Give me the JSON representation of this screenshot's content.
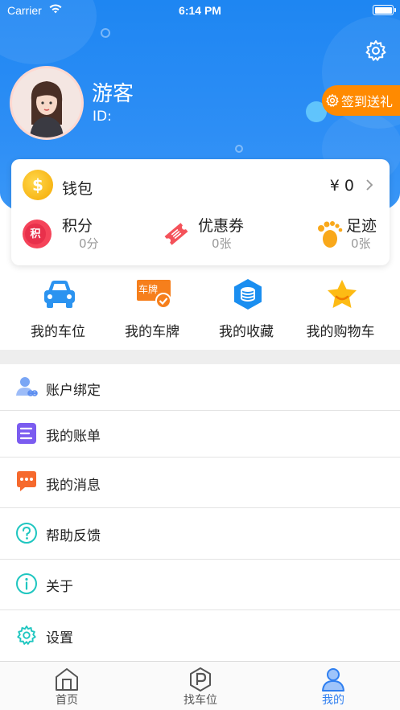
{
  "status_bar": {
    "carrier": "Carrier",
    "time": "6:14 PM"
  },
  "profile": {
    "name": "游客",
    "id_label": "ID:"
  },
  "signin": {
    "label": "签到送礼"
  },
  "wallet": {
    "label": "钱包",
    "amount": "¥ 0"
  },
  "stats": [
    {
      "title": "积分",
      "value": "0分",
      "icon": "points-icon",
      "badge": "积"
    },
    {
      "title": "优惠券",
      "value": "0张",
      "icon": "coupon-icon"
    },
    {
      "title": "足迹",
      "value": "0张",
      "icon": "footprint-icon"
    }
  ],
  "shortcuts": [
    {
      "label": "我的车位",
      "icon": "car-icon"
    },
    {
      "label": "我的车牌",
      "icon": "license-plate-icon",
      "badge": "车牌"
    },
    {
      "label": "我的收藏",
      "icon": "collection-icon"
    },
    {
      "label": "我的购物车",
      "icon": "star-cart-icon"
    }
  ],
  "menu": [
    {
      "label": "账户绑定",
      "icon": "account-bind-icon"
    },
    {
      "label": "我的账单",
      "icon": "bill-icon"
    },
    {
      "label": "我的消息",
      "icon": "message-icon"
    },
    {
      "label": "帮助反馈",
      "icon": "help-icon"
    },
    {
      "label": "关于",
      "icon": "info-icon"
    },
    {
      "label": "设置",
      "icon": "settings-icon"
    }
  ],
  "tabs": [
    {
      "label": "首页",
      "icon": "home-icon",
      "active": false
    },
    {
      "label": "找车位",
      "icon": "parking-icon",
      "active": false
    },
    {
      "label": "我的",
      "icon": "profile-icon",
      "active": true
    }
  ],
  "colors": {
    "header_blue": "#1e86f2",
    "accent_orange": "#ff8a00",
    "active_tab": "#2f7ff0"
  }
}
